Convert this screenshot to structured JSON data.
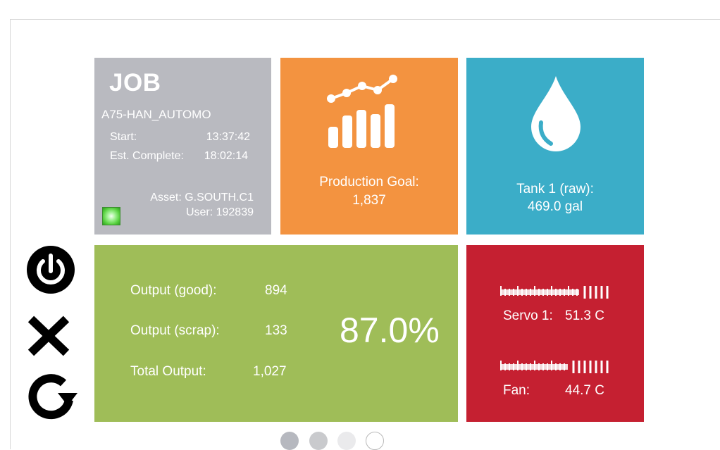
{
  "job": {
    "title": "JOB",
    "id": "A75-HAN_AUTOMO",
    "start_label": "Start:",
    "start_value": "13:37:42",
    "est_label": "Est. Complete:",
    "est_value": "18:02:14",
    "asset": "Asset: G.SOUTH.C1",
    "user": "User:  192839",
    "status_color": "#55cf3c"
  },
  "production": {
    "icon": "growth-chart-icon",
    "label": "Production Goal:",
    "value": "1,837",
    "color": "#f39340"
  },
  "tank": {
    "icon": "water-drop-icon",
    "label": "Tank 1 (raw):",
    "value": "469.0 gal",
    "color": "#3badc8"
  },
  "output": {
    "good_label": "Output (good):",
    "good_value": "894",
    "scrap_label": "Output (scrap):",
    "scrap_value": "133",
    "total_label": "Total Output:",
    "total_value": "1,027",
    "percent": "87.0%",
    "color": "#9fbd58"
  },
  "sensors": {
    "color": "#c52031",
    "servo_label": "Servo 1:",
    "servo_value": "51.3 C",
    "servo_level": 0.7,
    "fan_label": "Fan:",
    "fan_value": "44.7 C",
    "fan_level": 0.6
  },
  "controls": {
    "power_icon": "power-icon",
    "close_icon": "close-icon",
    "refresh_icon": "refresh-icon"
  },
  "pagination": {
    "pages": 4,
    "active": 1
  }
}
